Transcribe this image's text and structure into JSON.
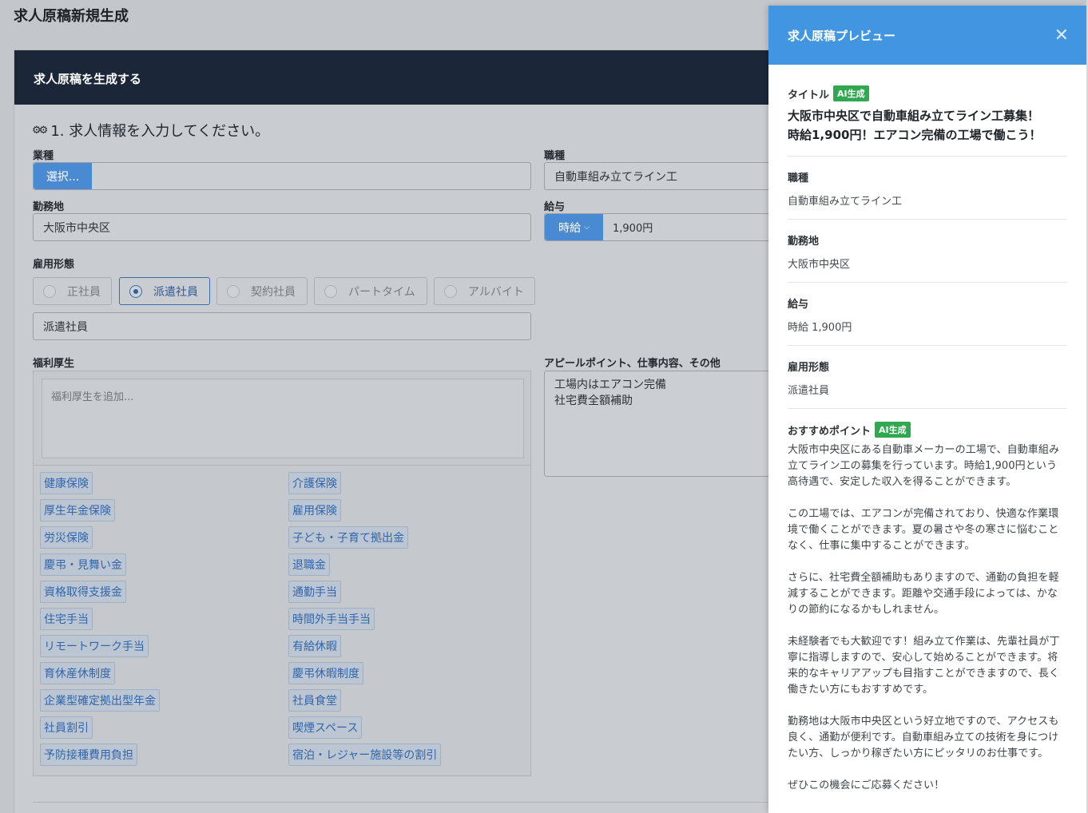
{
  "page_title": "求人原稿新規生成",
  "card": {
    "header": "求人原稿を生成する",
    "section_title": "1. 求人情報を入力してください。",
    "industry": {
      "label": "業種",
      "button": "選択..."
    },
    "job_type": {
      "label": "職種",
      "value": "自動車組み立てライン工"
    },
    "location": {
      "label": "勤務地",
      "value": "大阪市中央区"
    },
    "salary": {
      "label": "給与",
      "type": "時給",
      "value": "1,900円"
    },
    "employment": {
      "label": "雇用形態",
      "options": [
        "正社員",
        "派遣社員",
        "契約社員",
        "パートタイム",
        "アルバイト"
      ],
      "selected": "派遣社員",
      "value": "派遣社員"
    },
    "benefits": {
      "label": "福利厚生",
      "placeholder": "福利厚生を追加...",
      "left_tags": [
        "健康保険",
        "厚生年金保険",
        "労災保険",
        "慶弔・見舞い金",
        "資格取得支援金",
        "住宅手当",
        "リモートワーク手当",
        "育休産休制度",
        "企業型確定拠出型年金",
        "社員割引",
        "予防接種費用負担"
      ],
      "right_tags": [
        "介護保険",
        "雇用保険",
        "子ども・子育て拠出金",
        "退職金",
        "通勤手当",
        "時間外手当手当",
        "有給休暇",
        "慶弔休暇制度",
        "社員食堂",
        "喫煙スペース",
        "宿泊・レジャー施設等の割引"
      ]
    },
    "appeal": {
      "label": "アピールポイント、仕事内容、その他",
      "lines": [
        "工場内はエアコン完備",
        "社宅費全額補助"
      ]
    }
  },
  "preview": {
    "title": "求人原稿プレビュー",
    "ai_badge": "AI生成",
    "title_label": "タイトル",
    "job_title_line1": "大阪市中央区で自動車組み立てライン工募集！",
    "job_title_line2": "時給1,900円！エアコン完備の工場で働こう！",
    "job_type_label": "職種",
    "job_type": "自動車組み立てライン工",
    "location_label": "勤務地",
    "location": "大阪市中央区",
    "salary_label": "給与",
    "salary": "時給 1,900円",
    "employment_label": "雇用形態",
    "employment": "派遣社員",
    "recommend_label": "おすすめポイント",
    "paragraphs": [
      "大阪市中央区にある自動車メーカーの工場で、自動車組み立てライン工の募集を行っています。時給1,900円という高待遇で、安定した収入を得ることができます。",
      "この工場では、エアコンが完備されており、快適な作業環境で働くことができます。夏の暑さや冬の寒さに悩むことなく、仕事に集中することができます。",
      "さらに、社宅費全額補助もありますので、通勤の負担を軽減することができます。距離や交通手段によっては、かなりの節約になるかもしれません。",
      "未経験者でも大歓迎です！組み立て作業は、先輩社員が丁寧に指導しますので、安心して始めることができます。将来的なキャリアアップも目指すことができますので、長く働きたい方にもおすすめです。",
      "勤務地は大阪市中央区という好立地ですので、アクセスも良く、通勤が便利です。自動車組み立ての技術を身につけたい方、しっかり稼ぎたい方にピッタリのお仕事です。",
      "ぜひこの機会にご応募ください！"
    ]
  }
}
